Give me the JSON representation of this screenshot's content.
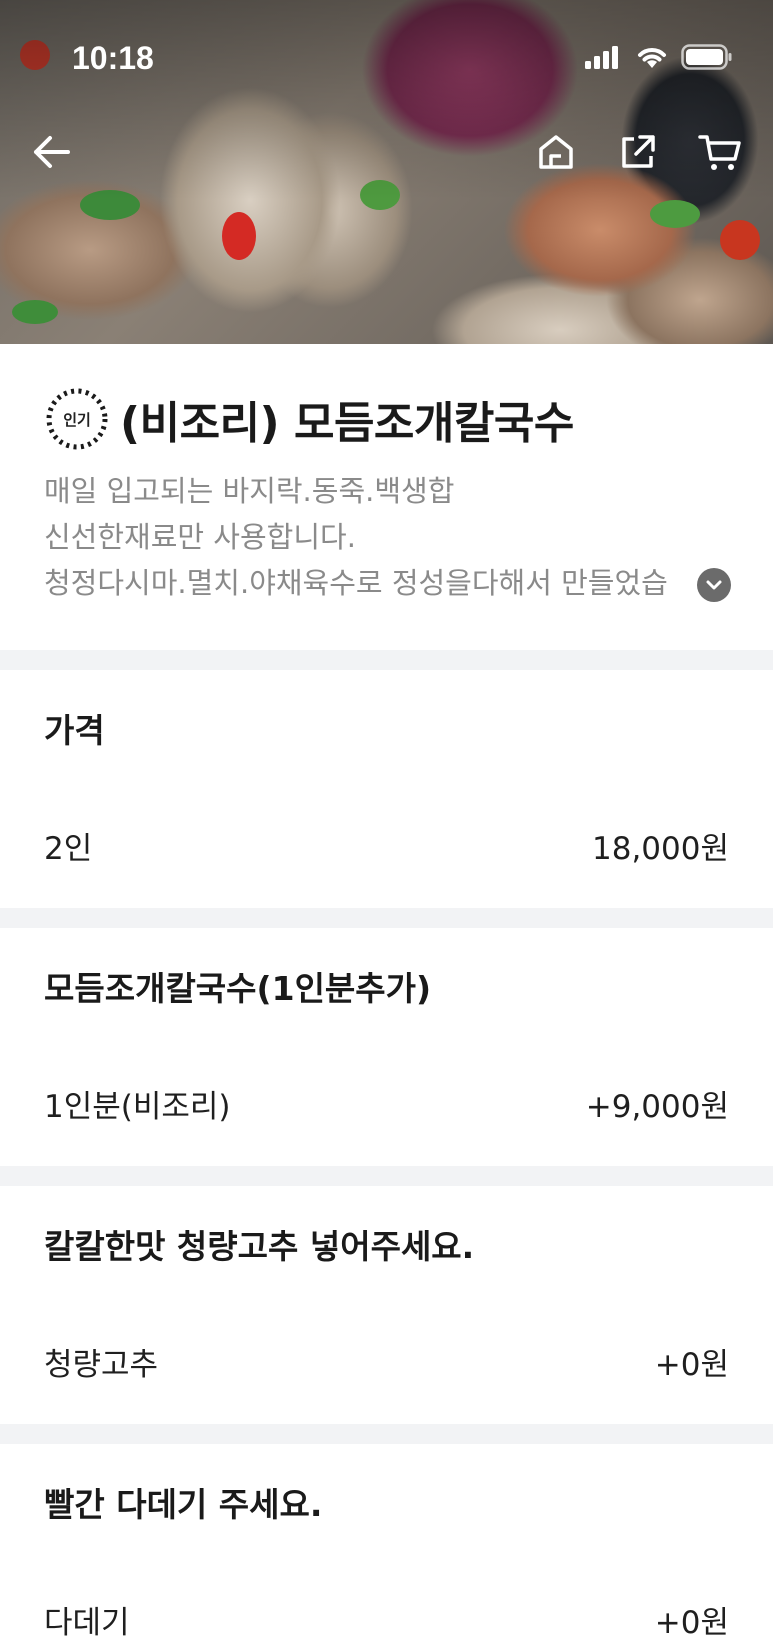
{
  "status_bar": {
    "time": "10:18"
  },
  "product": {
    "badge": "인기",
    "title": "(비조리) 모듬조개칼국수",
    "description": [
      "매일 입고되는 바지락.동죽.백생합",
      "신선한재료만 사용합니다.",
      "청정다시마.멸치.야채육수로 정성을다해서 만들었습"
    ]
  },
  "sections": [
    {
      "title": "가격",
      "option": "2인",
      "price": "18,000원"
    },
    {
      "title": "모듬조개칼국수(1인분추가)",
      "option": "1인분(비조리)",
      "price": "+9,000원"
    },
    {
      "title": "칼칼한맛 청량고추 넣어주세요.",
      "option": "청량고추",
      "price": "+0원"
    },
    {
      "title": "빨간 다데기 주세요.",
      "option": "다데기",
      "price": "+0원"
    }
  ],
  "icons": {
    "back": "back-arrow-icon",
    "home": "home-icon",
    "share": "share-icon",
    "cart": "cart-icon",
    "expand": "chevron-down-icon"
  }
}
